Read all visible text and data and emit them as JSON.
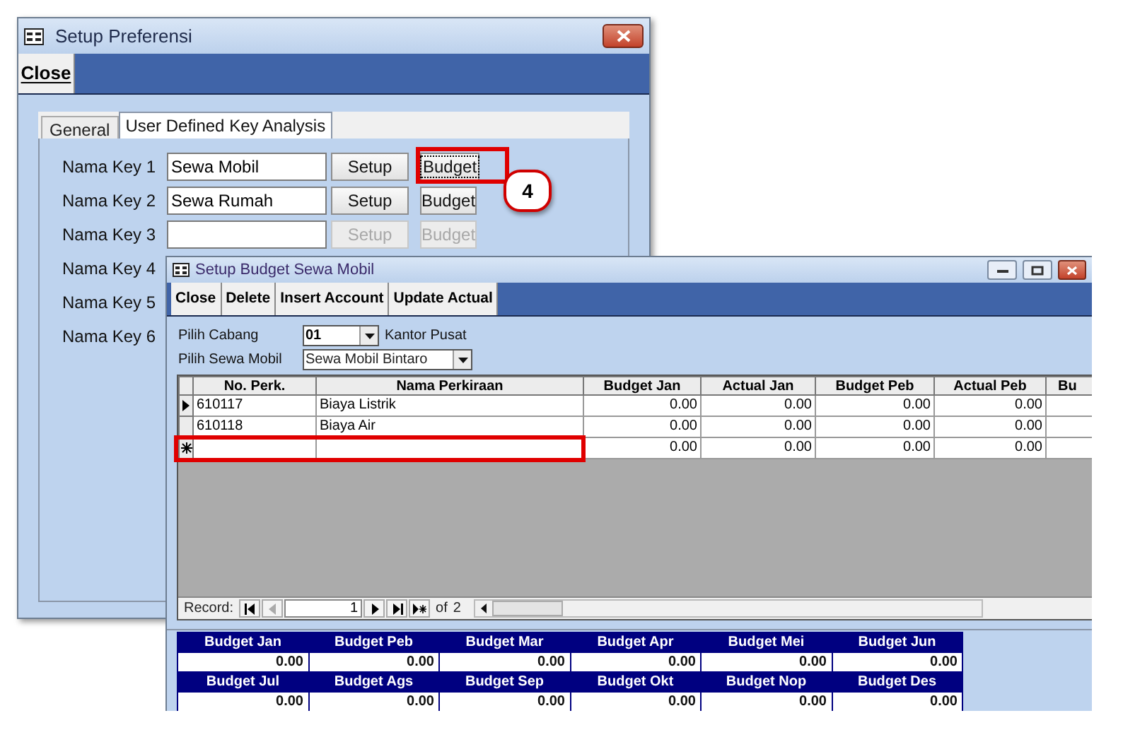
{
  "main_window": {
    "title": "Setup Preferensi",
    "toolbar": [
      {
        "label": "Close"
      }
    ],
    "tabs": [
      {
        "label": "General",
        "selected": false
      },
      {
        "label": "User Defined Key Analysis",
        "selected": true
      }
    ],
    "keys": [
      {
        "label": "Nama Key 1",
        "value": "Sewa Mobil",
        "setup": {
          "label": "Setup",
          "disabled": false
        },
        "budget": {
          "label": "Budget",
          "disabled": false,
          "focused": true
        }
      },
      {
        "label": "Nama Key 2",
        "value": "Sewa Rumah",
        "setup": {
          "label": "Setup",
          "disabled": false
        },
        "budget": {
          "label": "Budget",
          "disabled": false,
          "focused": false
        }
      },
      {
        "label": "Nama Key 3",
        "setup": {
          "label": "Setup",
          "disabled": true
        },
        "budget": {
          "label": "Budget",
          "disabled": true,
          "focused": false
        }
      },
      {
        "label": "Nama Key 4"
      },
      {
        "label": "Nama Key 5"
      },
      {
        "label": "Nama Key 6"
      }
    ]
  },
  "callout": {
    "number": "4"
  },
  "budget_window": {
    "title": "Setup Budget Sewa Mobil",
    "toolbar": [
      {
        "label": "Close"
      },
      {
        "label": "Delete"
      },
      {
        "label": "Insert Account"
      },
      {
        "label": "Update Actual"
      }
    ],
    "filters": [
      {
        "label": "Pilih Cabang",
        "value": "01",
        "caption": "Kantor Pusat"
      },
      {
        "label": "Pilih Sewa Mobil",
        "value": "Sewa Mobil Bintaro"
      }
    ],
    "grid": {
      "columns": [
        "No. Perk.",
        "Nama Perkiraan",
        "Budget Jan",
        "Actual Jan",
        "Budget Peb",
        "Actual Peb",
        "Bu"
      ],
      "rows": [
        {
          "current": true,
          "new": false,
          "cells": [
            "610117",
            "Biaya Listrik",
            "0.00",
            "0.00",
            "0.00",
            "0.00"
          ]
        },
        {
          "current": false,
          "new": false,
          "cells": [
            "610118",
            "Biaya Air",
            "0.00",
            "0.00",
            "0.00",
            "0.00"
          ]
        },
        {
          "current": false,
          "new": true,
          "cells": [
            "",
            "",
            "0.00",
            "0.00",
            "0.00",
            "0.00"
          ]
        }
      ]
    },
    "record_nav": {
      "label": "Record:",
      "value": "1",
      "of": "of",
      "total": "2"
    },
    "summary": [
      {
        "label": "Budget Jan",
        "value": "0.00"
      },
      {
        "label": "Budget Peb",
        "value": "0.00"
      },
      {
        "label": "Budget Mar",
        "value": "0.00"
      },
      {
        "label": "Budget Apr",
        "value": "0.00"
      },
      {
        "label": "Budget Mei",
        "value": "0.00"
      },
      {
        "label": "Budget Jun",
        "value": "0.00"
      },
      {
        "label": "Budget Jul",
        "value": "0.00"
      },
      {
        "label": "Budget Ags",
        "value": "0.00"
      },
      {
        "label": "Budget Sep",
        "value": "0.00"
      },
      {
        "label": "Budget Okt",
        "value": "0.00"
      },
      {
        "label": "Budget Nop",
        "value": "0.00"
      },
      {
        "label": "Budget Des",
        "value": "0.00"
      }
    ]
  }
}
